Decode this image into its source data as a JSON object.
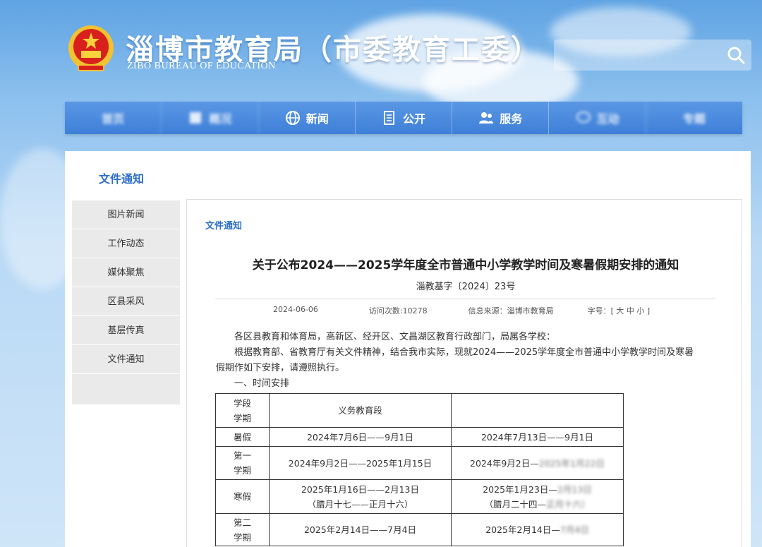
{
  "header": {
    "site_title": "淄博市教育局（市委教育工委）",
    "site_subtitle": "ZIBO BUREAU OF EDUCATION",
    "search_icon": "search-icon"
  },
  "nav": {
    "items": [
      {
        "label": "首页",
        "icon": "home-icon",
        "blurred": true
      },
      {
        "label": "概况",
        "icon": "info-icon",
        "blurred": true
      },
      {
        "label": "新闻",
        "icon": "globe-icon",
        "blurred": false
      },
      {
        "label": "公开",
        "icon": "document-icon",
        "blurred": false
      },
      {
        "label": "服务",
        "icon": "users-icon",
        "blurred": false
      },
      {
        "label": "互动",
        "icon": "chat-icon",
        "blurred": true
      },
      {
        "label": "专题",
        "icon": "topic-icon",
        "blurred": true
      }
    ]
  },
  "section_title": "文件通知",
  "sidebar": {
    "items": [
      "图片新闻",
      "工作动态",
      "媒体聚焦",
      "区县采风",
      "基层传真",
      "文件通知"
    ]
  },
  "content": {
    "crumb": "文件通知",
    "title": "关于公布2024——2025学年度全市普通中小学教学时间及寒暑假期安排的通知",
    "doc_number": "淄教基字〔2024〕23号",
    "meta": {
      "date": "2024-06-06",
      "visits": "访问次数:10278",
      "source": "信息来源：淄博市教育局",
      "font_size": "字号：[ 大 中 小 ]"
    },
    "para1": "各区县教育和体育局，高新区、经开区、文昌湖区教育行政部门，局属各学校：",
    "para2_line1": "根据教育部、省教育厅有关文件精神，结合我市实际，现就2024——2025学年度全市普通中小学教学时间及寒暑",
    "para2_line2": "假期作如下安排，请遵照执行。",
    "section1": "一、时间安排"
  },
  "schedule": {
    "header_col1_top": "学段",
    "header_col1_bottom": "学期",
    "header_col2": "义务教育段",
    "header_col3": "",
    "rows": [
      {
        "term": "暑假",
        "col2": "2024年7月6日——9月1日",
        "col3": "2024年7月13日——9月1日",
        "col3_blur": ""
      },
      {
        "term_top": "第一",
        "term_bottom": "学期",
        "col2": "2024年9月2日——2025年1月15日",
        "col3": "2024年9月2日—",
        "col3_blur": "2025年1月22日"
      },
      {
        "term": "寒假",
        "col2_top": "2025年1月16日——2月13日",
        "col2_bottom": "（腊月十七——正月十六）",
        "col3_top": "2025年1月23日—",
        "col3_top_blur": "2月13日",
        "col3_bottom": "（腊月二十四—",
        "col3_bottom_blur": "正月十六）"
      },
      {
        "term_top": "第二",
        "term_bottom": "学期",
        "col2": "2025年2月14日——7月4日",
        "col3": "2025年2月14日—",
        "col3_blur": "7月4日"
      }
    ]
  },
  "colors": {
    "nav_bg": "#3e7fd8",
    "accent": "#2c6fc9",
    "sidebar_bg": "#eaeaea"
  }
}
